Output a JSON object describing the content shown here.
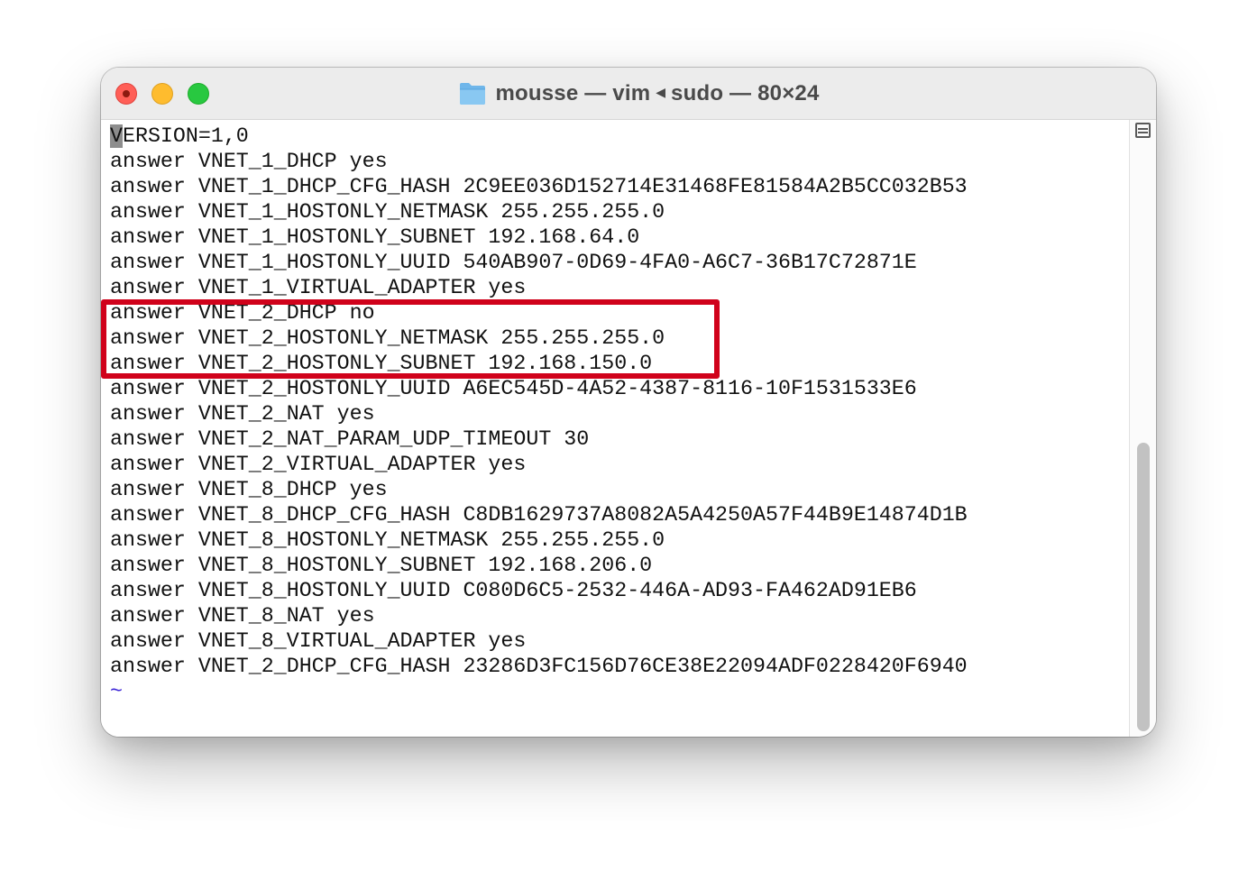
{
  "window": {
    "title_left": "mousse — vim",
    "title_right": "sudo — 80×24",
    "title_separator_icon": "left-triangle-icon",
    "folder_icon": "folder-icon",
    "traffic_lights": {
      "close": "#ff5f57",
      "minimize": "#febc2e",
      "zoom": "#28c840"
    }
  },
  "terminal": {
    "cursor_char": "V",
    "first_line_rest": "ERSION=1,0",
    "lines": [
      "answer VNET_1_DHCP yes",
      "answer VNET_1_DHCP_CFG_HASH 2C9EE036D152714E31468FE81584A2B5CC032B53",
      "answer VNET_1_HOSTONLY_NETMASK 255.255.255.0",
      "answer VNET_1_HOSTONLY_SUBNET 192.168.64.0",
      "answer VNET_1_HOSTONLY_UUID 540AB907-0D69-4FA0-A6C7-36B17C72871E",
      "answer VNET_1_VIRTUAL_ADAPTER yes",
      "answer VNET_2_DHCP no",
      "answer VNET_2_HOSTONLY_NETMASK 255.255.255.0",
      "answer VNET_2_HOSTONLY_SUBNET 192.168.150.0",
      "answer VNET_2_HOSTONLY_UUID A6EC545D-4A52-4387-8116-10F1531533E6",
      "answer VNET_2_NAT yes",
      "answer VNET_2_NAT_PARAM_UDP_TIMEOUT 30",
      "answer VNET_2_VIRTUAL_ADAPTER yes",
      "answer VNET_8_DHCP yes",
      "answer VNET_8_DHCP_CFG_HASH C8DB1629737A8082A5A4250A57F44B9E14874D1B",
      "answer VNET_8_HOSTONLY_NETMASK 255.255.255.0",
      "answer VNET_8_HOSTONLY_SUBNET 192.168.206.0",
      "answer VNET_8_HOSTONLY_UUID C080D6C5-2532-446A-AD93-FA462AD91EB6",
      "answer VNET_8_NAT yes",
      "answer VNET_8_VIRTUAL_ADAPTER yes",
      "answer VNET_2_DHCP_CFG_HASH 23286D3FC156D76CE38E22094ADF0228420F6940"
    ],
    "empty_line_marker": "~",
    "highlight_color": "#d0021b",
    "tilde_color": "#3b24d6"
  }
}
